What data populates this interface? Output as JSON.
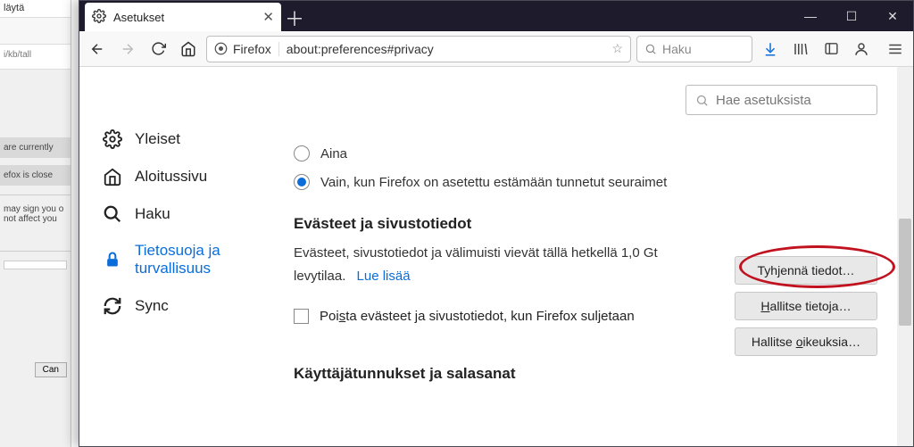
{
  "bg": {
    "title": "läytä",
    "url_frag": "i/kb/tall",
    "strip1": "are currently",
    "strip2": "efox is close",
    "note1": "may sign you o",
    "note2": "not affect you",
    "cancel": "Can"
  },
  "tab": {
    "title": "Asetukset"
  },
  "url": {
    "identity": "Firefox",
    "address": "about:preferences#privacy"
  },
  "search": {
    "placeholder": "Haku"
  },
  "settings_search": {
    "placeholder": "Hae asetuksista"
  },
  "sidebar": {
    "general": "Yleiset",
    "home": "Aloitussivu",
    "search": "Haku",
    "privacy_l1": "Tietosuoja ja",
    "privacy_l2": "turvallisuus",
    "sync": "Sync"
  },
  "radios": {
    "always": "Aina",
    "only": "Vain, kun Firefox on asetettu estämään tunnetut seuraimet"
  },
  "sections": {
    "cookies_title": "Evästeet ja sivustotiedot",
    "cookies_desc": "Evästeet, sivustotiedot ja välimuisti vievät tällä hetkellä 1,0 Gt levytilaa.",
    "learn_more": "Lue lisää",
    "clear_chk_pre": "Poi",
    "clear_chk_s": "s",
    "clear_chk_post": "ta evästeet ja sivustotiedot, kun Firefox suljetaan",
    "logins_title": "Käyttäjätunnukset ja salasanat"
  },
  "buttons": {
    "clear": "Tyhjennä tiedot…",
    "manage_pre": "",
    "manage_H": "H",
    "manage_post": "allitse tietoja…",
    "perm_pre": "Hallitse ",
    "perm_o": "o",
    "perm_post": "ikeuksia…"
  }
}
